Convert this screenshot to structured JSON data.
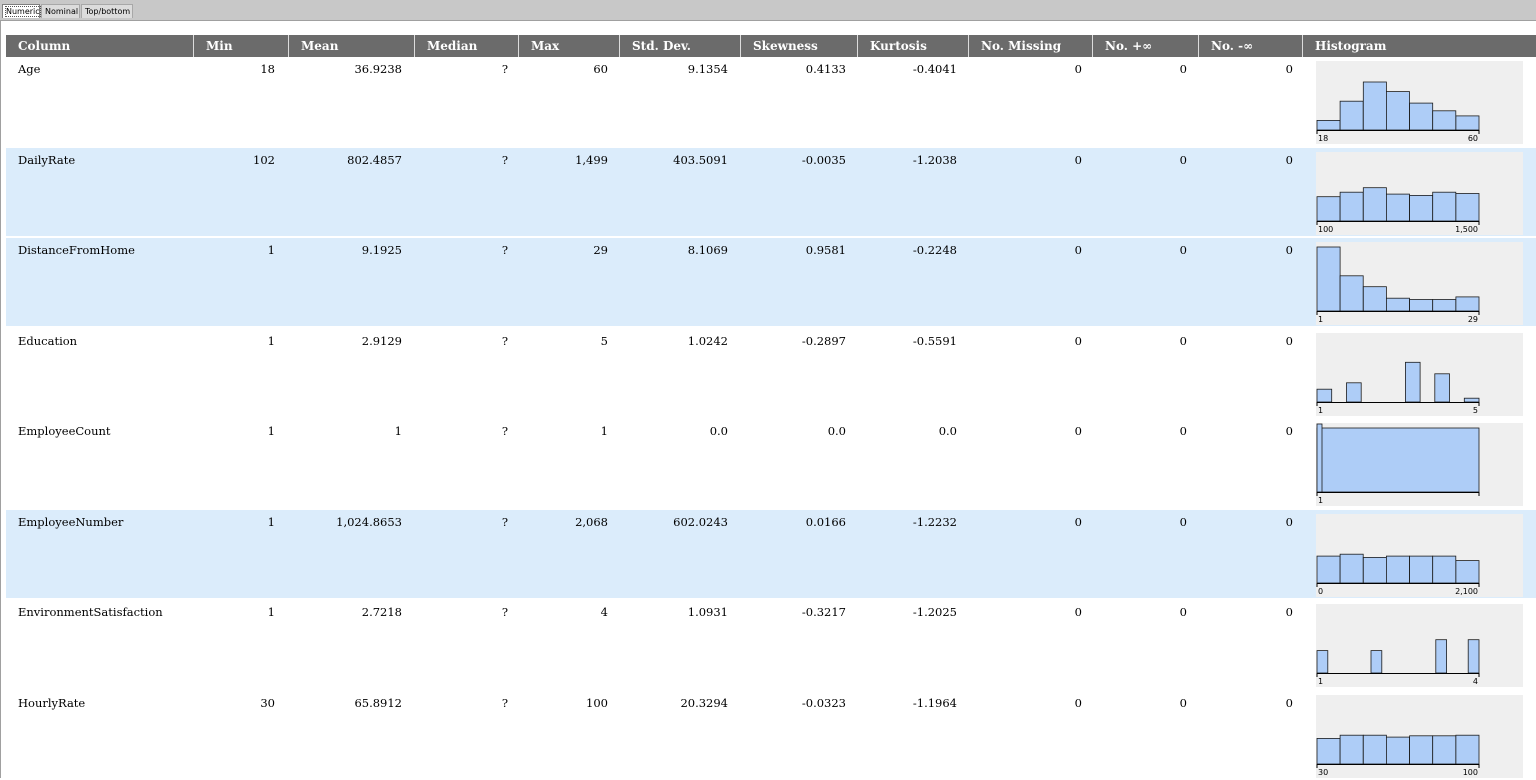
{
  "tabs": [
    {
      "label": "Numeric",
      "active": true
    },
    {
      "label": "Nominal",
      "active": false
    },
    {
      "label": "Top/bottom",
      "active": false
    }
  ],
  "columns": [
    "Column",
    "Min",
    "Mean",
    "Median",
    "Max",
    "Std. Dev.",
    "Skewness",
    "Kurtosis",
    "No. Missing",
    "No. +∞",
    "No. -∞",
    "Histogram"
  ],
  "colors": {
    "header_bg": "#6b6b6b",
    "row_highlight": "#dbecfb",
    "bar_fill": "#aecdf7",
    "bar_stroke": "#1b1b1b",
    "hist_bg": "#efefef"
  },
  "rows": [
    {
      "column": "Age",
      "min": "18",
      "mean": "36.9238",
      "median": "?",
      "max": "60",
      "std": "9.1354",
      "skew": "0.4133",
      "kurt": "-0.4041",
      "missing": "0",
      "pinf": "0",
      "ninf": "0",
      "highlight": false,
      "hist": {
        "bins": [
          0.15,
          0.45,
          0.75,
          0.6,
          0.42,
          0.3,
          0.22
        ],
        "min_label": "18",
        "max_label": "60"
      }
    },
    {
      "column": "DailyRate",
      "min": "102",
      "mean": "802.4857",
      "median": "?",
      "max": "1,499",
      "std": "403.5091",
      "skew": "-0.0035",
      "kurt": "-1.2038",
      "missing": "0",
      "pinf": "0",
      "ninf": "0",
      "highlight": true,
      "hist": {
        "bins": [
          0.38,
          0.45,
          0.52,
          0.42,
          0.4,
          0.45,
          0.43
        ],
        "min_label": "100",
        "max_label": "1,500"
      }
    },
    {
      "column": "DistanceFromHome",
      "min": "1",
      "mean": "9.1925",
      "median": "?",
      "max": "29",
      "std": "8.1069",
      "skew": "0.9581",
      "kurt": "-0.2248",
      "missing": "0",
      "pinf": "0",
      "ninf": "0",
      "highlight": true,
      "hist": {
        "bins": [
          1.0,
          0.55,
          0.38,
          0.2,
          0.18,
          0.18,
          0.22
        ],
        "min_label": "1",
        "max_label": "29"
      }
    },
    {
      "column": "Education",
      "min": "1",
      "mean": "2.9129",
      "median": "?",
      "max": "5",
      "std": "1.0242",
      "skew": "-0.2897",
      "kurt": "-0.5591",
      "missing": "0",
      "pinf": "0",
      "ninf": "0",
      "highlight": false,
      "hist": {
        "bins": [
          0.2,
          0,
          0.3,
          0,
          0,
          0,
          0.62,
          0,
          0.44,
          0,
          0.06
        ],
        "min_label": "1",
        "max_label": "5"
      }
    },
    {
      "column": "EmployeeCount",
      "min": "1",
      "mean": "1",
      "median": "?",
      "max": "1",
      "std": "0.0",
      "skew": "0.0",
      "kurt": "0.0",
      "missing": "0",
      "pinf": "0",
      "ninf": "0",
      "highlight": false,
      "hist": {
        "bins": [
          1.0
        ],
        "min_label": "1",
        "max_label": ""
      }
    },
    {
      "column": "EmployeeNumber",
      "min": "1",
      "mean": "1,024.8653",
      "median": "?",
      "max": "2,068",
      "std": "602.0243",
      "skew": "0.0166",
      "kurt": "-1.2232",
      "missing": "0",
      "pinf": "0",
      "ninf": "0",
      "highlight": true,
      "hist": {
        "bins": [
          0.42,
          0.45,
          0.4,
          0.42,
          0.42,
          0.42,
          0.35
        ],
        "min_label": "0",
        "max_label": "2,100"
      }
    },
    {
      "column": "EnvironmentSatisfaction",
      "min": "1",
      "mean": "2.7218",
      "median": "?",
      "max": "4",
      "std": "1.0931",
      "skew": "-0.3217",
      "kurt": "-1.2025",
      "missing": "0",
      "pinf": "0",
      "ninf": "0",
      "highlight": false,
      "hist": {
        "bins": [
          0.35,
          0,
          0,
          0,
          0,
          0.35,
          0,
          0,
          0,
          0,
          0,
          0.52,
          0,
          0,
          0.52
        ],
        "min_label": "1",
        "max_label": "4"
      }
    },
    {
      "column": "HourlyRate",
      "min": "30",
      "mean": "65.8912",
      "median": "?",
      "max": "100",
      "std": "20.3294",
      "skew": "-0.0323",
      "kurt": "-1.1964",
      "missing": "0",
      "pinf": "0",
      "ninf": "0",
      "highlight": false,
      "hist": {
        "bins": [
          0.4,
          0.45,
          0.45,
          0.42,
          0.44,
          0.44,
          0.45
        ],
        "min_label": "30",
        "max_label": "100"
      }
    }
  ]
}
